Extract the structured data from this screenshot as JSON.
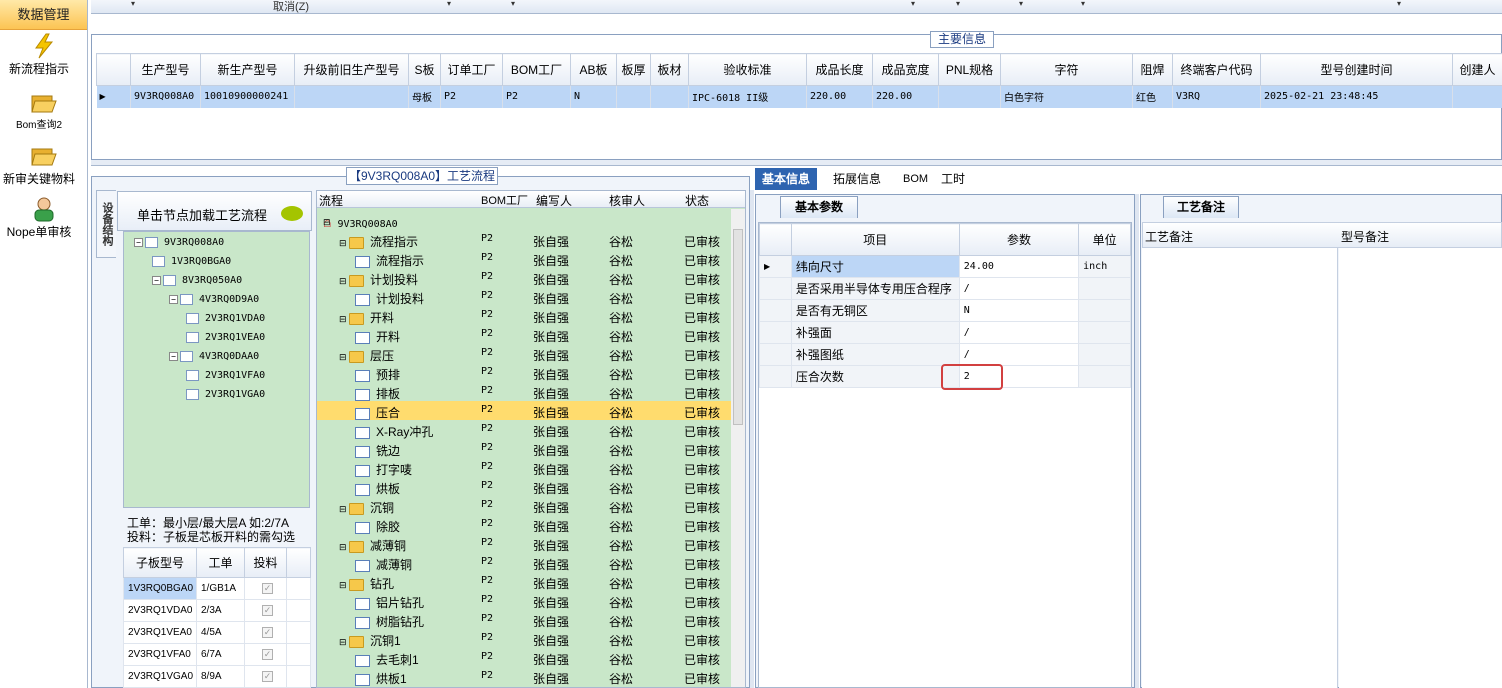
{
  "nav": {
    "title": "数据管理",
    "items": [
      {
        "label": "新流程指示",
        "icon": "lightning-icon"
      },
      {
        "label": "Bom查询2",
        "icon": "folder-open-icon"
      },
      {
        "label": "新审关键物料",
        "icon": "folder-open-icon"
      },
      {
        "label": "Nope单审核",
        "icon": "user-icon"
      }
    ]
  },
  "toolbar": {
    "cancel_label": "取消(Z)"
  },
  "main": {
    "title": "主要信息",
    "columns": [
      "生产型号",
      "新生产型号",
      "升级前旧生产型号",
      "S板",
      "订单工厂",
      "BOM工厂",
      "AB板",
      "板厚",
      "板材",
      "验收标准",
      "成品长度",
      "成品宽度",
      "PNL规格",
      "字符",
      "阻焊",
      "终端客户代码",
      "型号创建时间",
      "创建人"
    ],
    "row": [
      "9V3RQ008A0",
      "10010900000241",
      "",
      "母板",
      "P2",
      "P2",
      "N",
      "",
      "",
      "IPC-6018 II级",
      "220.00",
      "220.00",
      "",
      "白色字符",
      "红色",
      "V3RQ",
      "2025-02-21 23:48:45",
      ""
    ]
  },
  "process": {
    "title": "【9V3RQ008A0】工艺流程",
    "vtab": "设备结构",
    "tree_header": "单击节点加载工艺流程",
    "tree": [
      "9V3RQ008A0",
      "1V3RQ0BGA0",
      "8V3RQ050A0",
      "4V3RQ0D9A0",
      "2V3RQ1VDA0",
      "2V3RQ1VEA0",
      "4V3RQ0DAA0",
      "2V3RQ1VFA0",
      "2V3RQ1VGA0"
    ],
    "note_line1": "工单：最小层/最大层A 如:2/7A",
    "note_line2": "投料：子板是芯板开料的需勾选",
    "sub_columns": [
      "子板型号",
      "工单",
      "投料"
    ],
    "sub_rows": [
      {
        "model": "1V3RQ0BGA0",
        "order": "1/GB1A"
      },
      {
        "model": "2V3RQ1VDA0",
        "order": "2/3A"
      },
      {
        "model": "2V3RQ1VEA0",
        "order": "4/5A"
      },
      {
        "model": "2V3RQ1VFA0",
        "order": "6/7A"
      },
      {
        "model": "2V3RQ1VGA0",
        "order": "8/9A"
      }
    ],
    "flow_columns": [
      "流程",
      "BOM工厂",
      "编写人",
      "核审人",
      "状态"
    ],
    "flow_rows": [
      {
        "name": "9V3RQ008A0",
        "level": 0,
        "type": "home",
        "factory": "",
        "writer": "",
        "reviewer": "",
        "status": ""
      },
      {
        "name": "流程指示",
        "level": 1,
        "type": "folder",
        "factory": "P2",
        "writer": "张自强",
        "reviewer": "谷松",
        "status": "已审核"
      },
      {
        "name": "流程指示",
        "level": 2,
        "type": "doc",
        "factory": "P2",
        "writer": "张自强",
        "reviewer": "谷松",
        "status": "已审核"
      },
      {
        "name": "计划投料",
        "level": 1,
        "type": "folder",
        "factory": "P2",
        "writer": "张自强",
        "reviewer": "谷松",
        "status": "已审核"
      },
      {
        "name": "计划投料",
        "level": 2,
        "type": "doc",
        "factory": "P2",
        "writer": "张自强",
        "reviewer": "谷松",
        "status": "已审核"
      },
      {
        "name": "开料",
        "level": 1,
        "type": "folder",
        "factory": "P2",
        "writer": "张自强",
        "reviewer": "谷松",
        "status": "已审核"
      },
      {
        "name": "开料",
        "level": 2,
        "type": "doc",
        "factory": "P2",
        "writer": "张自强",
        "reviewer": "谷松",
        "status": "已审核"
      },
      {
        "name": "层压",
        "level": 1,
        "type": "folder",
        "factory": "P2",
        "writer": "张自强",
        "reviewer": "谷松",
        "status": "已审核"
      },
      {
        "name": "预排",
        "level": 2,
        "type": "doc",
        "factory": "P2",
        "writer": "张自强",
        "reviewer": "谷松",
        "status": "已审核"
      },
      {
        "name": "排板",
        "level": 2,
        "type": "doc",
        "factory": "P2",
        "writer": "张自强",
        "reviewer": "谷松",
        "status": "已审核"
      },
      {
        "name": "压合",
        "level": 2,
        "type": "doc",
        "factory": "P2",
        "writer": "张自强",
        "reviewer": "谷松",
        "status": "已审核",
        "selected": true
      },
      {
        "name": "X-Ray冲孔",
        "level": 2,
        "type": "doc",
        "factory": "P2",
        "writer": "张自强",
        "reviewer": "谷松",
        "status": "已审核"
      },
      {
        "name": "铣边",
        "level": 2,
        "type": "doc",
        "factory": "P2",
        "writer": "张自强",
        "reviewer": "谷松",
        "status": "已审核"
      },
      {
        "name": "打字唛",
        "level": 2,
        "type": "doc",
        "factory": "P2",
        "writer": "张自强",
        "reviewer": "谷松",
        "status": "已审核"
      },
      {
        "name": "烘板",
        "level": 2,
        "type": "doc",
        "factory": "P2",
        "writer": "张自强",
        "reviewer": "谷松",
        "status": "已审核"
      },
      {
        "name": "沉铜",
        "level": 1,
        "type": "folder",
        "factory": "P2",
        "writer": "张自强",
        "reviewer": "谷松",
        "status": "已审核"
      },
      {
        "name": "除胶",
        "level": 2,
        "type": "doc",
        "factory": "P2",
        "writer": "张自强",
        "reviewer": "谷松",
        "status": "已审核"
      },
      {
        "name": "减薄铜",
        "level": 1,
        "type": "folder",
        "factory": "P2",
        "writer": "张自强",
        "reviewer": "谷松",
        "status": "已审核"
      },
      {
        "name": "减薄铜",
        "level": 2,
        "type": "doc",
        "factory": "P2",
        "writer": "张自强",
        "reviewer": "谷松",
        "status": "已审核"
      },
      {
        "name": "钻孔",
        "level": 1,
        "type": "folder",
        "factory": "P2",
        "writer": "张自强",
        "reviewer": "谷松",
        "status": "已审核"
      },
      {
        "name": "铝片钻孔",
        "level": 2,
        "type": "doc",
        "factory": "P2",
        "writer": "张自强",
        "reviewer": "谷松",
        "status": "已审核"
      },
      {
        "name": "树脂钻孔",
        "level": 2,
        "type": "doc",
        "factory": "P2",
        "writer": "张自强",
        "reviewer": "谷松",
        "status": "已审核"
      },
      {
        "name": "沉铜1",
        "level": 1,
        "type": "folder",
        "factory": "P2",
        "writer": "张自强",
        "reviewer": "谷松",
        "status": "已审核"
      },
      {
        "name": "去毛刺1",
        "level": 2,
        "type": "doc",
        "factory": "P2",
        "writer": "张自强",
        "reviewer": "谷松",
        "status": "已审核"
      },
      {
        "name": "烘板1",
        "level": 2,
        "type": "doc",
        "factory": "P2",
        "writer": "张自强",
        "reviewer": "谷松",
        "status": "已审核"
      }
    ]
  },
  "detail": {
    "tabs": [
      "基本信息",
      "拓展信息",
      "BOM",
      "工时"
    ],
    "subtab": "基本参数",
    "param_columns": [
      "项目",
      "参数",
      "单位"
    ],
    "params": [
      {
        "item": "纬向尺寸",
        "value": "24.00",
        "unit": "inch"
      },
      {
        "item": "是否采用半导体专用压合程序",
        "value": "/",
        "unit": ""
      },
      {
        "item": "是否有无铜区",
        "value": "N",
        "unit": ""
      },
      {
        "item": "补强面",
        "value": "/",
        "unit": ""
      },
      {
        "item": "补强图纸",
        "value": "/",
        "unit": ""
      },
      {
        "item": "压合次数",
        "value": "2",
        "unit": ""
      }
    ],
    "remark_tab": "工艺备注",
    "remark_columns": [
      "工艺备注",
      "型号备注"
    ]
  }
}
